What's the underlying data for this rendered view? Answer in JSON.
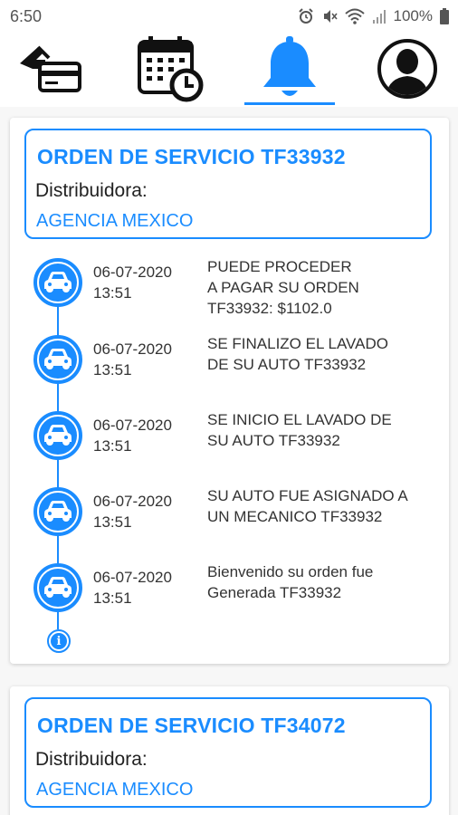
{
  "status_bar": {
    "time": "6:50",
    "battery": "100%",
    "icons": [
      "alarm-icon",
      "mute-icon",
      "wifi-icon",
      "signal-icon",
      "battery-icon"
    ]
  },
  "tabs": [
    {
      "name": "payments",
      "icon": "card-payment-icon",
      "active": false
    },
    {
      "name": "schedule",
      "icon": "calendar-clock-icon",
      "active": false
    },
    {
      "name": "notifications",
      "icon": "bell-icon",
      "active": true
    },
    {
      "name": "profile",
      "icon": "user-icon",
      "active": false
    }
  ],
  "accent_color": "#1a8cff",
  "orders": [
    {
      "title": "ORDEN DE SERVICIO TF33932",
      "dist_label": "Distribuidora:",
      "dist_value": "AGENCIA MEXICO",
      "events": [
        {
          "date": "06-07-2020",
          "time": "13:51",
          "text": [
            "PUEDE PROCEDER",
            "A PAGAR SU ORDEN",
            "TF33932: $1102.0"
          ]
        },
        {
          "date": "06-07-2020",
          "time": "13:51",
          "text": [
            "SE FINALIZO EL LAVADO",
            "DE SU AUTO TF33932"
          ]
        },
        {
          "date": "06-07-2020",
          "time": "13:51",
          "text": [
            "SE INICIO EL LAVADO DE",
            "SU AUTO TF33932"
          ]
        },
        {
          "date": "06-07-2020",
          "time": "13:51",
          "text": [
            "SU AUTO FUE ASIGNADO A",
            "UN MECANICO TF33932"
          ]
        },
        {
          "date": "06-07-2020",
          "time": "13:51",
          "text": [
            "Bienvenido su orden fue",
            "Generada TF33932"
          ]
        }
      ]
    },
    {
      "title": "ORDEN DE SERVICIO TF34072",
      "dist_label": "Distribuidora:",
      "dist_value": "AGENCIA MEXICO"
    }
  ]
}
